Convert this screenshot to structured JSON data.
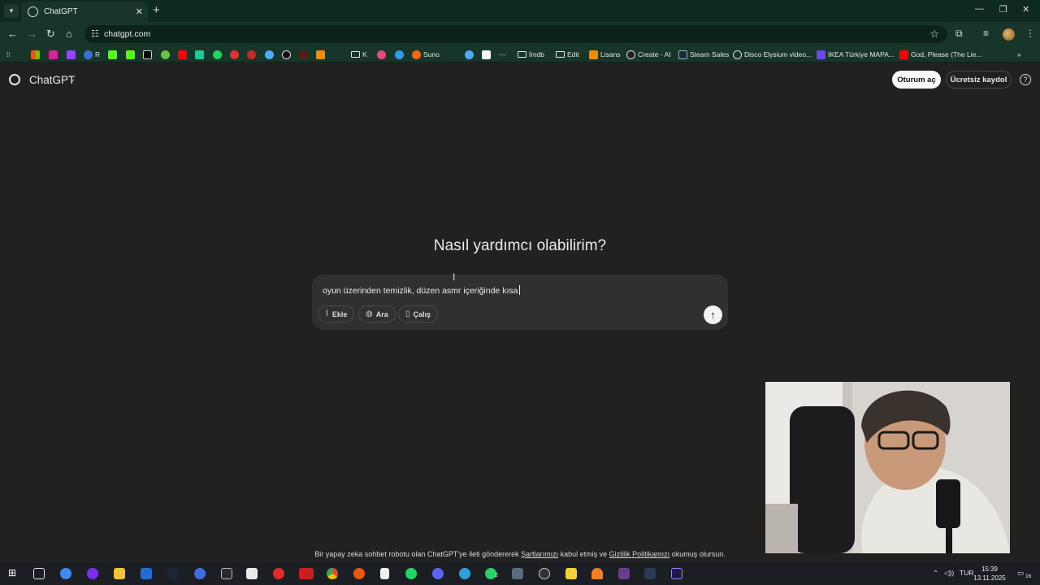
{
  "browser": {
    "tab_title": "ChatGPT",
    "url": "chatgpt.com",
    "bookmarks": [
      {
        "label": "R",
        "icon": "r-icon"
      },
      {
        "label": "K",
        "icon": "folder-icon"
      },
      {
        "label": "Suno",
        "icon": "suno-icon"
      },
      {
        "label": "İmdb",
        "icon": "folder-icon"
      },
      {
        "label": "Edit",
        "icon": "folder-icon"
      },
      {
        "label": "Lisans",
        "icon": "lisans-icon"
      },
      {
        "label": "Create - AI",
        "icon": "create-ai-icon"
      },
      {
        "label": "Steam Sales",
        "icon": "steam-icon"
      },
      {
        "label": "Disco Elysium video...",
        "icon": "globe-icon"
      },
      {
        "label": "IKEA Türkiye MAPA...",
        "icon": "k-icon"
      },
      {
        "label": "God, Please (The Lie...",
        "icon": "youtube-icon"
      }
    ]
  },
  "header": {
    "brand": "ChatGPT",
    "login_label": "Oturum aç",
    "signup_label": "Ücretsiz kaydol",
    "help_glyph": "?"
  },
  "main": {
    "headline": "Nasıl yardımcı olabilirim?",
    "prompt_text": "oyun üzerinden temizlik, düzen asmr içeriğinde kısa",
    "buttons": {
      "attach_label": "Ekle",
      "search_label": "Ara",
      "study_label": "Çalış"
    }
  },
  "footer": {
    "prefix": "Bir yapay zeka sohbet robotu olan ChatGPT'ye ileti göndererek ",
    "terms_link": "Şartlarımızı",
    "middle": " kabul etmiş ve ",
    "privacy_link": "Gizlilik Politikamızı",
    "suffix": " okumuş olursun."
  },
  "taskbar": {
    "language": "TUR",
    "time": "15:39",
    "date": "13.11.2025",
    "notification_count": "16",
    "whatsapp_badge": "2"
  }
}
